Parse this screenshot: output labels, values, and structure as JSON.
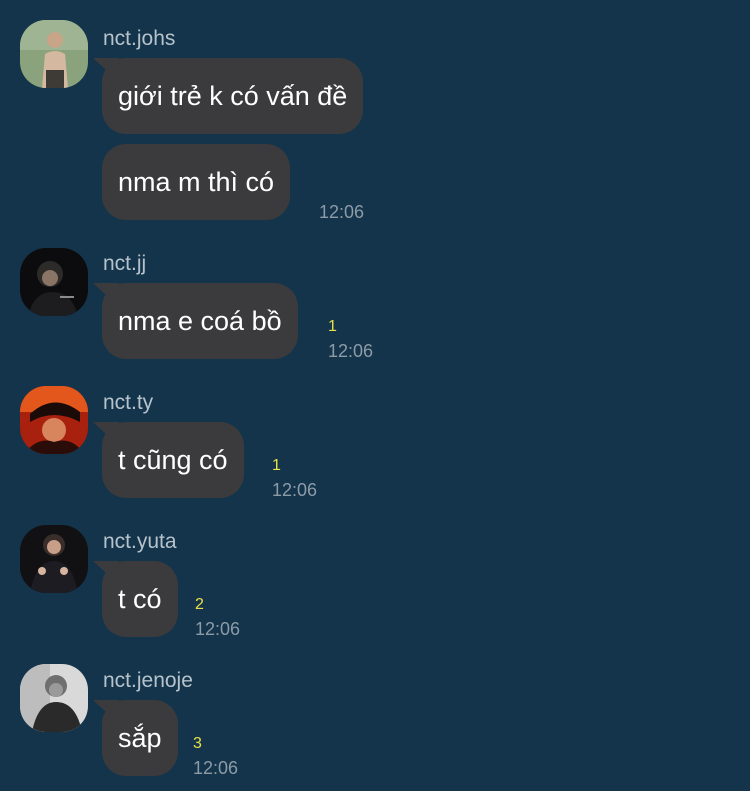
{
  "colors": {
    "background": "#13344a",
    "bubble": "#3b3b3e",
    "unread": "#e8e04a",
    "name": "#b6c2cc",
    "timestamp": "#8d9ba7"
  },
  "messages": [
    {
      "sender": "nct.johs",
      "avatar_icon": "user-avatar-icon",
      "bubbles": [
        "giới trẻ k có vấn đề",
        "nma m thì có"
      ],
      "unread": "",
      "time": "12:06"
    },
    {
      "sender": "nct.jj",
      "avatar_icon": "user-avatar-icon",
      "bubbles": [
        "nma e coá bồ"
      ],
      "unread": "1",
      "time": "12:06"
    },
    {
      "sender": "nct.ty",
      "avatar_icon": "user-avatar-icon",
      "bubbles": [
        "t cũng có"
      ],
      "unread": "1",
      "time": "12:06"
    },
    {
      "sender": "nct.yuta",
      "avatar_icon": "user-avatar-icon",
      "bubbles": [
        "t có"
      ],
      "unread": "2",
      "time": "12:06"
    },
    {
      "sender": "nct.jenoje",
      "avatar_icon": "user-avatar-icon",
      "bubbles": [
        "sắp"
      ],
      "unread": "3",
      "time": "12:06"
    }
  ]
}
